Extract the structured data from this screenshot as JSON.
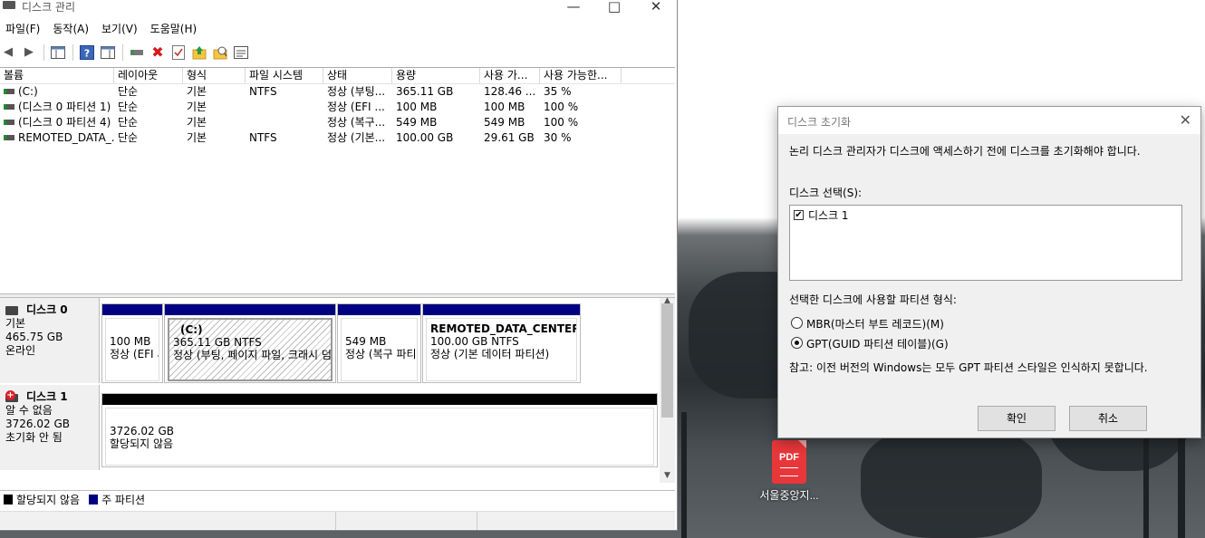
{
  "main_window": {
    "title": "디스크 관리",
    "menu": [
      "파일(F)",
      "동작(A)",
      "보기(V)",
      "도움말(H)"
    ],
    "columns": [
      "볼륨",
      "레이아웃",
      "형식",
      "파일 시스템",
      "상태",
      "용량",
      "사용 가...",
      "사용 가능한..."
    ],
    "volumes": [
      {
        "name": "(C:)",
        "layout": "단순",
        "type": "기본",
        "fs": "NTFS",
        "status": "정상 (부팅...",
        "capacity": "365.11 GB",
        "free": "128.46 ...",
        "pct": "35 %"
      },
      {
        "name": "(디스크 0 파티션 1)",
        "layout": "단순",
        "type": "기본",
        "fs": "",
        "status": "정상 (EFI ...",
        "capacity": "100 MB",
        "free": "100 MB",
        "pct": "100 %"
      },
      {
        "name": "(디스크 0 파티션 4)",
        "layout": "단순",
        "type": "기본",
        "fs": "",
        "status": "정상 (복구...",
        "capacity": "549 MB",
        "free": "549 MB",
        "pct": "100 %"
      },
      {
        "name": "REMOTED_DATA_...",
        "layout": "단순",
        "type": "기본",
        "fs": "NTFS",
        "status": "정상 (기본...",
        "capacity": "100.00 GB",
        "free": "29.61 GB",
        "pct": "30 %"
      }
    ],
    "disks": [
      {
        "name": "디스크 0",
        "kind": "기본",
        "size": "465.75 GB",
        "state": "온라인",
        "partitions": [
          {
            "title": "",
            "size": "100 MB",
            "desc": "정상 (EFI 시스"
          },
          {
            "title": "(C:)",
            "size": "365.11 GB NTFS",
            "desc": "정상 (부팅, 페이지 파일, 크래시 덤"
          },
          {
            "title": "",
            "size": "549 MB",
            "desc": "정상 (복구 파티"
          },
          {
            "title": "REMOTED_DATA_CENTER  (I",
            "size": "100.00 GB NTFS",
            "desc": "정상 (기본 데이터 파티션)"
          }
        ]
      },
      {
        "name": "디스크 1",
        "kind": "알 수 없음",
        "size": "3726.02 GB",
        "state": "초기화 안 됨",
        "partitions": [
          {
            "title": "",
            "size": "3726.02 GB",
            "desc": "할당되지 않음"
          }
        ]
      }
    ],
    "legend": [
      {
        "label": "할당되지 않음",
        "color": "#000000"
      },
      {
        "label": "주 파티션",
        "color": "#000080"
      }
    ]
  },
  "dialog": {
    "title": "디스크 초기화",
    "intro": "논리 디스크 관리자가 디스크에 액세스하기 전에 디스크를 초기화해야 합니다.",
    "select_label": "디스크 선택(S):",
    "disk_item": "디스크 1",
    "partition_label": "선택한 디스크에 사용할 파티션 형식:",
    "mbr": "MBR(마스터 부트 레코드)(M)",
    "gpt": "GPT(GUID 파티션 테이블)(G)",
    "note": "참고: 이전 버전의 Windows는 모두 GPT 파티션 스타일은 인식하지 못합니다.",
    "ok": "확인",
    "cancel": "취소"
  },
  "desktop_icon": {
    "label": "서울중앙지...",
    "badge": "PDF"
  }
}
